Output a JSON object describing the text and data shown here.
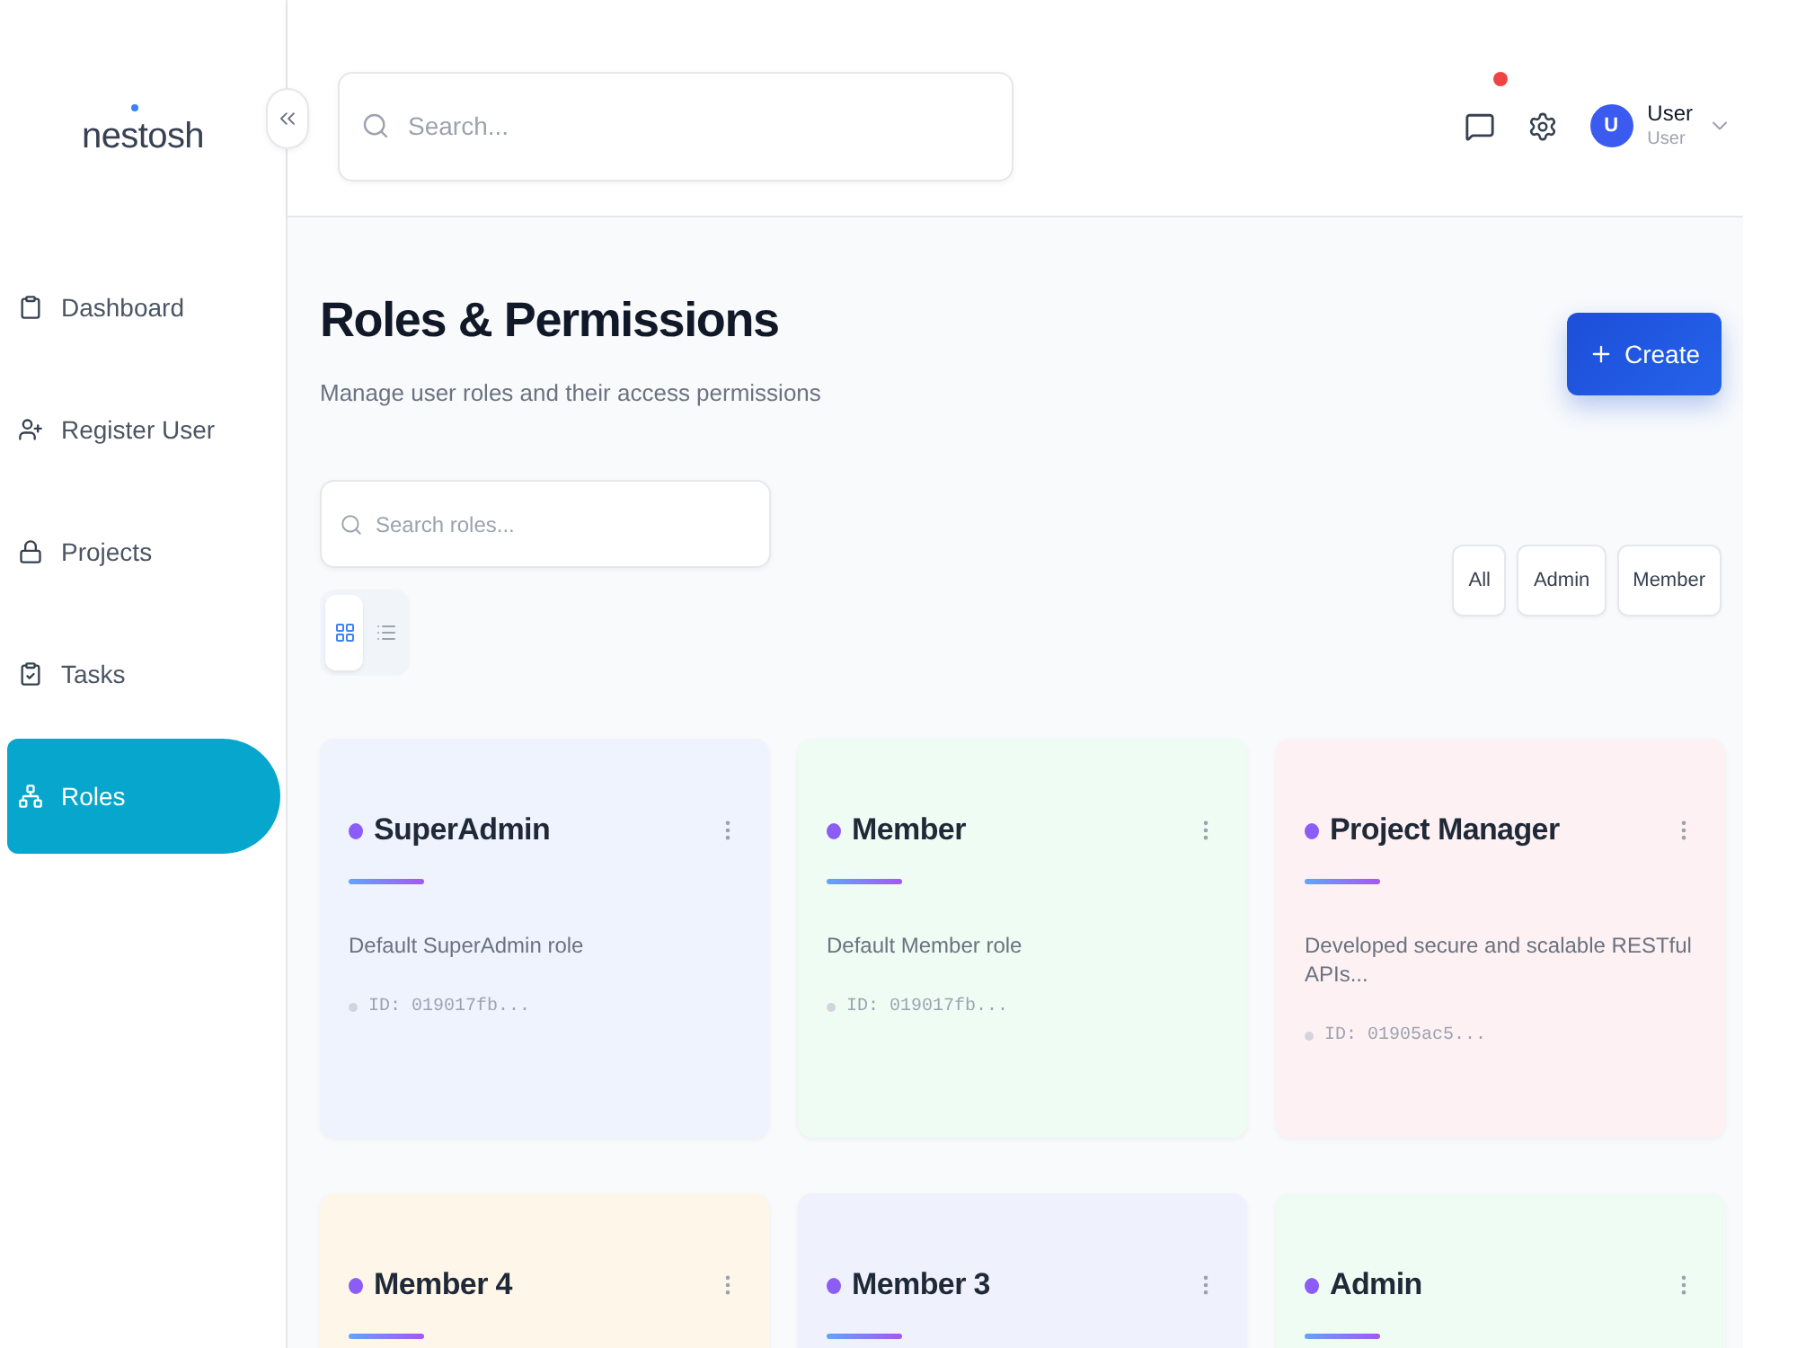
{
  "sidebar": {
    "logo": "nestosh",
    "items": [
      {
        "label": "Dashboard",
        "selected": false
      },
      {
        "label": "Register User",
        "selected": false
      },
      {
        "label": "Projects",
        "selected": false
      },
      {
        "label": "Tasks",
        "selected": false
      },
      {
        "label": "Roles",
        "selected": true
      }
    ]
  },
  "header": {
    "search": {
      "placeholder": "Search..."
    },
    "notifications": {
      "unread": true
    },
    "user": {
      "initial": "U",
      "name": "User",
      "role": "User"
    }
  },
  "page": {
    "title": "Roles & Permissions",
    "subtitle": "Manage user roles and their access permissions",
    "create_button": "Create"
  },
  "toolbar": {
    "search": {
      "placeholder": "Search roles..."
    },
    "view_modes": [
      {
        "selected": true
      },
      {
        "selected": false
      }
    ],
    "filters": [
      {
        "label": "All",
        "selected": false
      },
      {
        "label": "Admin",
        "selected": false
      },
      {
        "label": "Member",
        "selected": false
      }
    ]
  },
  "cards": [
    {
      "title": "SuperAdmin",
      "description": "Default SuperAdmin role",
      "id": "ID: 019017fb...",
      "color": "#eef3fe"
    },
    {
      "title": "Member",
      "description": "Default Member role",
      "id": "ID: 019017fb...",
      "color": "#eefcf4"
    },
    {
      "title": "Project Manager",
      "description": "Developed secure and scalable RESTful APIs...",
      "id": "ID: 01905ac5...",
      "color": "#fdf1f3"
    },
    {
      "title": "Member 4",
      "color": "#fff6ea"
    },
    {
      "title": "Member 3",
      "color": "#eff1fd"
    },
    {
      "title": "Admin",
      "color": "#effcf3"
    }
  ]
}
